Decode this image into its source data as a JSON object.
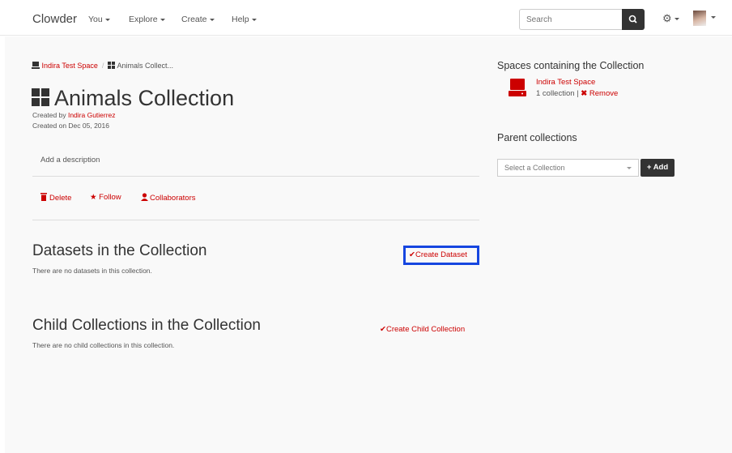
{
  "navbar": {
    "brand": "Clowder",
    "items": [
      {
        "label": "You"
      },
      {
        "label": "Explore"
      },
      {
        "label": "Create"
      },
      {
        "label": "Help"
      }
    ],
    "search_placeholder": "Search"
  },
  "breadcrumb": {
    "space": "Indira Test Space",
    "separator": "/",
    "current": "Animals Collect..."
  },
  "collection": {
    "title": "Animals Collection",
    "created_by_prefix": "Created by ",
    "created_by_name": "Indira Gutierrez",
    "created_on": "Created on Dec 05, 2016",
    "description_placeholder": "Add a description"
  },
  "actions": {
    "delete": "Delete",
    "follow": "Follow",
    "collaborators": "Collaborators"
  },
  "datasets_section": {
    "heading": "Datasets in the Collection",
    "empty_text": "There are no datasets in this collection.",
    "create_label": "Create Dataset"
  },
  "child_section": {
    "heading": "Child Collections in the Collection",
    "empty_text": "There are no child collections in this collection.",
    "create_label": "Create Child Collection"
  },
  "sidebar": {
    "spaces_heading": "Spaces containing the Collection",
    "space_name": "Indira Test Space",
    "space_count": "1 collection |",
    "remove_label": "Remove",
    "parent_heading": "Parent collections",
    "select_placeholder": "Select a Collection",
    "add_label": "Add"
  },
  "colors": {
    "accent": "#cc0000",
    "highlight": "#1646e0",
    "dark_button": "#333333"
  }
}
